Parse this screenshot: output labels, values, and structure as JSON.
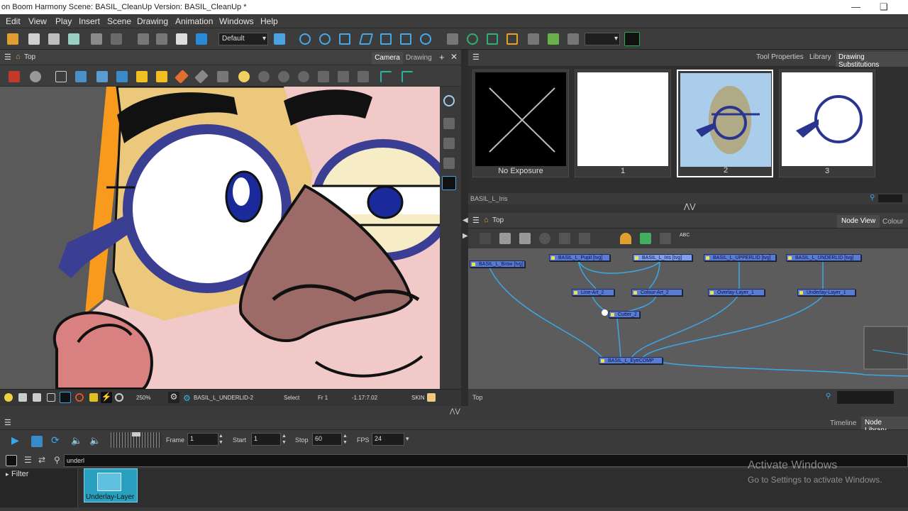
{
  "window": {
    "title": "on Boom Harmony Scene: BASIL_CleanUp Version: BASIL_CleanUp *",
    "minimize_icon": "minimize-icon",
    "restore_icon": "restore-icon"
  },
  "menu": [
    "Edit",
    "View",
    "Play",
    "Insert",
    "Scene",
    "Drawing",
    "Animation",
    "Windows",
    "Help"
  ],
  "toolbar": {
    "preset_select": "Default"
  },
  "view_panel": {
    "title": "Top",
    "tabs": [
      "Camera",
      "Drawing"
    ],
    "status": {
      "zoom": "250%",
      "layer": "BASIL_L_UNDERLID-2",
      "tool": "Select",
      "frame": "Fr 1",
      "coords": "-1.17:7.02",
      "skin_label": "SKIN"
    }
  },
  "right_panel": {
    "tabs": [
      "Tool Properties",
      "Library",
      "Drawing Substitutions"
    ],
    "active_tab": "Drawing Substitutions",
    "thumbnails": [
      {
        "caption": "No Exposure"
      },
      {
        "caption": "1"
      },
      {
        "caption": "2"
      },
      {
        "caption": "3"
      }
    ],
    "drawing_name": "BASIL_L_Iris"
  },
  "node_view": {
    "title": "Top",
    "tabs": [
      "Node View",
      "Colour"
    ],
    "active_tab": "Node View",
    "footer": "Top",
    "nodes": [
      {
        "id": "brow",
        "label": "BASIL_L_Brow [tvg]"
      },
      {
        "id": "pupil",
        "label": "BASIL_L_Pupil [tvg]"
      },
      {
        "id": "iris",
        "label": "BASIL_L_Iris [tvg]"
      },
      {
        "id": "upperlid",
        "label": "BASIL_L_UPPERLID [tvg]"
      },
      {
        "id": "underlid",
        "label": "BASIL_L_UNDERLID [tvg]"
      },
      {
        "id": "lineart",
        "label": "Line-Art_2"
      },
      {
        "id": "colourart",
        "label": "Colour-Art_2"
      },
      {
        "id": "overlay",
        "label": "Overlay-Layer_1"
      },
      {
        "id": "underlay",
        "label": "Underlay-Layer_1"
      },
      {
        "id": "cutter",
        "label": "Cutter_2"
      },
      {
        "id": "comp",
        "label": "BASIL_L_EyeCOMP"
      }
    ]
  },
  "bottom_tabs": [
    "Timeline",
    "Node Library"
  ],
  "active_bottom_tab": "Node Library",
  "playback": {
    "frame_label": "Frame",
    "frame": "1",
    "start_label": "Start",
    "start": "1",
    "stop_label": "Stop",
    "stop": "60",
    "fps_label": "FPS",
    "fps": "24"
  },
  "library": {
    "search_value": "underl",
    "filter_label": "Filter",
    "item_label": "Underlay-Layer"
  },
  "watermark": {
    "line1": "Activate Windows",
    "line2": "Go to Settings to activate Windows."
  },
  "colors": {
    "glasses": "#3a3f94",
    "skin": "#f2c9c9",
    "face_tan": "#ebc87c",
    "nose": "#9c6b68",
    "hair": "#f79a1e",
    "node": "#5a7bd0",
    "highlight_blue": "#a9cdeb"
  }
}
